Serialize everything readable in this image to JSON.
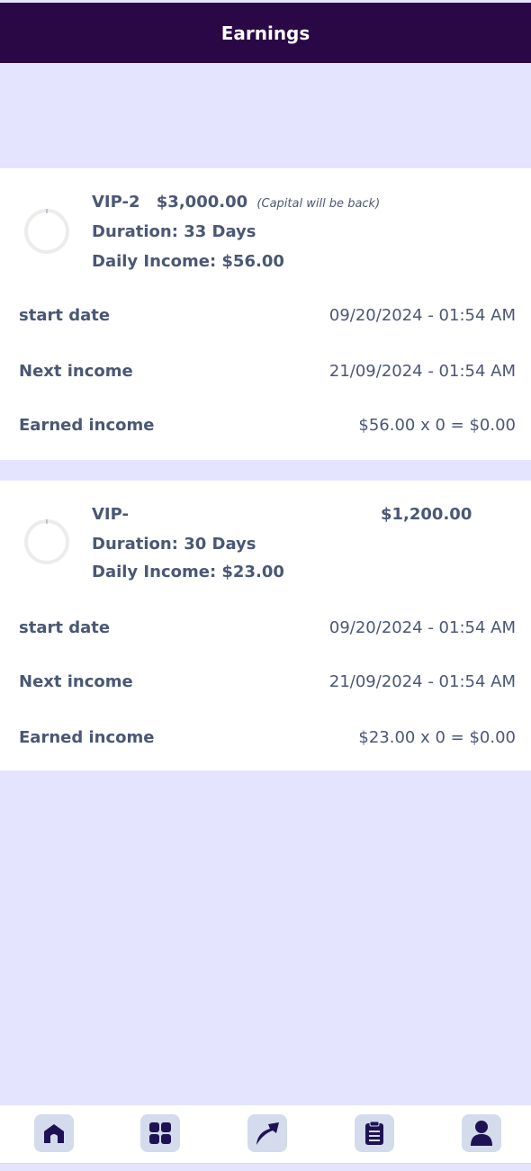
{
  "header": {
    "title": "Earnings"
  },
  "plans": [
    {
      "name": "VIP-2",
      "amount": "$3,000.00",
      "note": "(Capital will be back)",
      "duration": "Duration: 33 Days",
      "daily_income": "Daily Income: $56.00",
      "rows": [
        {
          "label": "start date",
          "value": "09/20/2024 - 01:54 AM"
        },
        {
          "label": "Next income",
          "value": "21/09/2024 - 01:54 AM"
        },
        {
          "label": "Earned income",
          "value": "$56.00 x 0 = $0.00"
        }
      ]
    },
    {
      "name": "VIP-",
      "amount": "$1,200.00",
      "duration": "Duration: 30 Days",
      "daily_income": "Daily Income: $23.00",
      "rows": [
        {
          "label": "start date",
          "value": "09/20/2024 - 01:54 AM"
        },
        {
          "label": "Next income",
          "value": "21/09/2024 - 01:54 AM"
        },
        {
          "label": "Earned income",
          "value": "$23.00 x 0 = $0.00"
        }
      ]
    }
  ],
  "nav": {
    "items": [
      {
        "icon": "home-icon"
      },
      {
        "icon": "grid-icon"
      },
      {
        "icon": "share-arrow-icon"
      },
      {
        "icon": "clipboard-icon"
      },
      {
        "icon": "user-icon"
      }
    ]
  },
  "colors": {
    "header_bg": "#2a0745",
    "page_bg": "#e5e4fe",
    "text": "#4a5775",
    "nav_button_bg": "#d3dbec",
    "icon": "#1e1254"
  }
}
